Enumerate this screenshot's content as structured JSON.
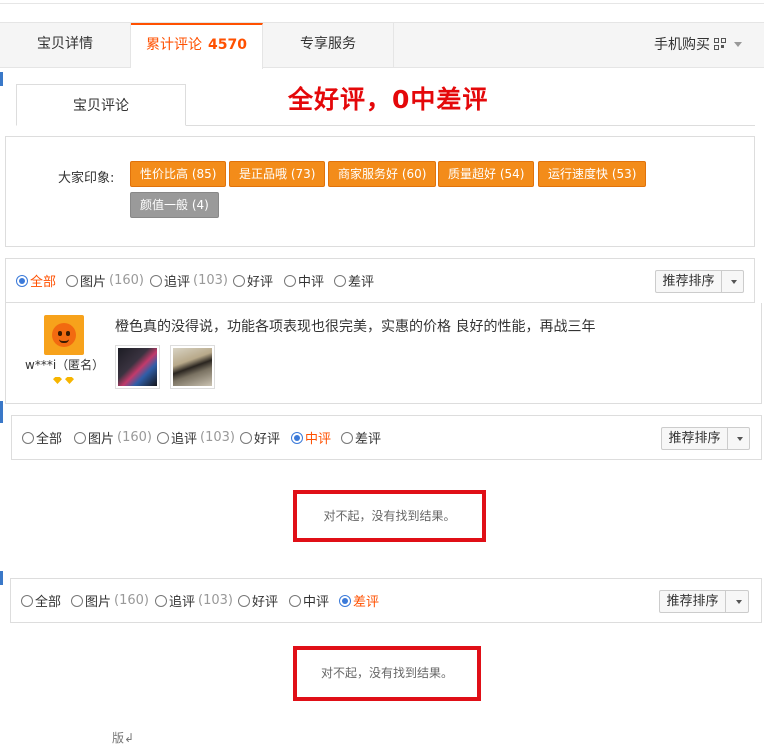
{
  "tabs": {
    "detail": "宝贝详情",
    "reviews_label": "累计评论",
    "reviews_count": "4570",
    "service": "专享服务",
    "mobile_buy": "手机购买"
  },
  "subtab": "宝贝评论",
  "headline": "全好评，0中差评",
  "impressions": {
    "label": "大家印象:",
    "tags": [
      "性价比高 (85)",
      "是正品哦 (73)",
      "商家服务好 (60)",
      "质量超好 (54)",
      "运行速度快 (53)",
      "颜值一般 (4)"
    ]
  },
  "filters": {
    "all": "全部",
    "pictures": "图片",
    "pictures_count": "(160)",
    "followup": "追评",
    "followup_count": "(103)",
    "positive": "好评",
    "neutral": "中评",
    "negative": "差评",
    "sort_label": "推荐排序"
  },
  "review": {
    "user": "w***i（匿名）",
    "text": "橙色真的没得说，功能各项表现也很完美，实惠的价格 良好的性能，再战三年"
  },
  "empty_message": "对不起，没有找到结果。",
  "footer_fragment": "版↲"
}
